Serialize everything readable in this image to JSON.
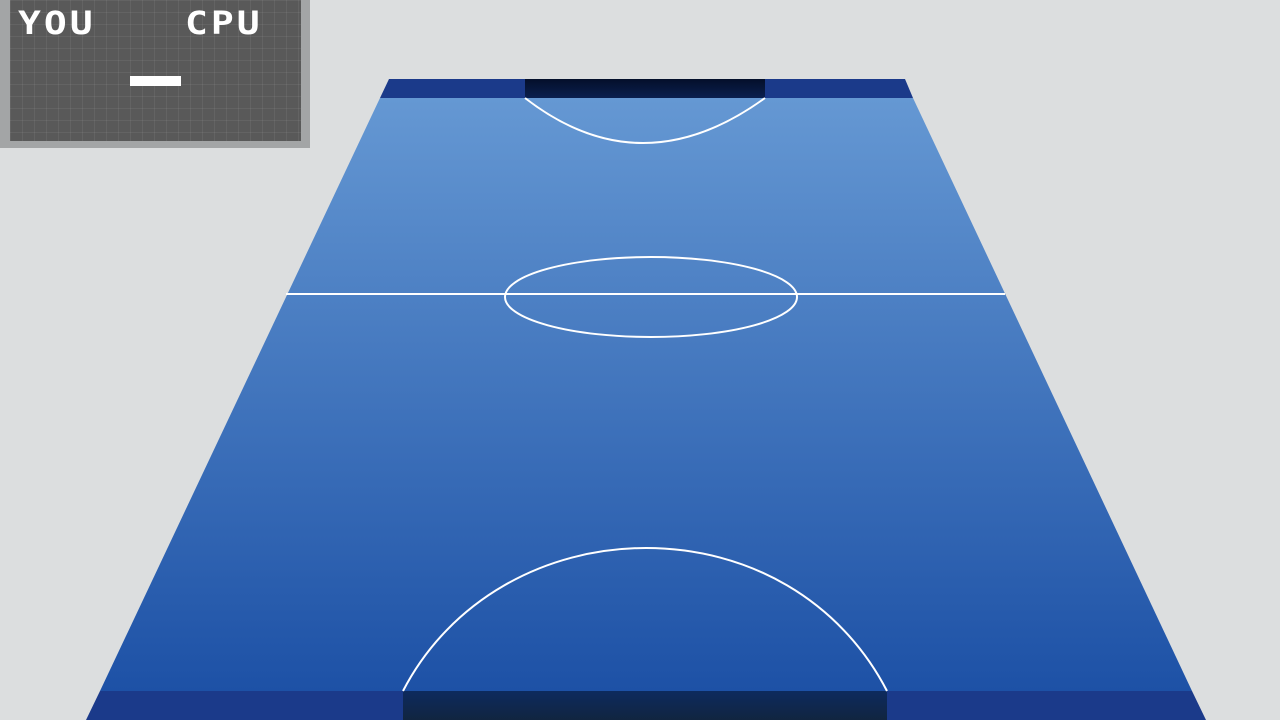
{
  "scoreboard": {
    "player_label": "YOU",
    "cpu_label": "CPU",
    "separator": "—"
  },
  "rink": {
    "surface_top_color": "#6598d3",
    "surface_bottom_color": "#1d51a6",
    "rail_color": "#1b3a8a",
    "goal_color": "#040f2a",
    "line_color": "#ffffff"
  },
  "background_color": "#dcdedf"
}
